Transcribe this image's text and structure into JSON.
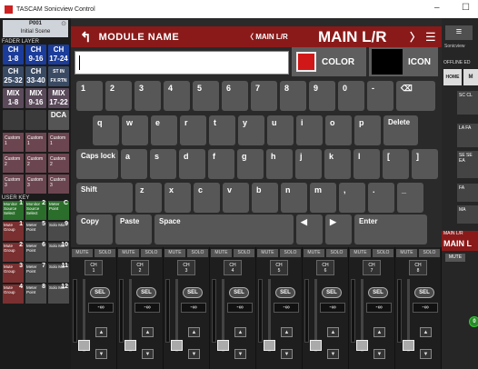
{
  "window": {
    "title": "TASCAM Sonicview Control",
    "controls": [
      "–",
      "☐"
    ]
  },
  "left_panel": {
    "preset": {
      "number": "P001",
      "name": "Initial Scene",
      "scroll": "⊙"
    },
    "fader_layer_label": "FADER LAYER",
    "layers": [
      {
        "l1": "CH",
        "l2": "1-8",
        "style": "ch"
      },
      {
        "l1": "CH",
        "l2": "9-16",
        "style": "ch"
      },
      {
        "l1": "CH",
        "l2": "17-24",
        "style": "ch"
      },
      {
        "l1": "CH",
        "l2": "25-32",
        "style": "chg"
      },
      {
        "l1": "CH",
        "l2": "33-40",
        "style": "chg"
      },
      {
        "l1": "ST IN",
        "l2": "FX RTN",
        "style": "chg"
      },
      {
        "l1": "MIX",
        "l2": "1-8",
        "style": "mix"
      },
      {
        "l1": "MIX",
        "l2": "9-16",
        "style": "mix"
      },
      {
        "l1": "MIX",
        "l2": "17-22",
        "style": "mix"
      },
      {
        "l1": "",
        "l2": "",
        "style": "empty"
      },
      {
        "l1": "",
        "l2": "",
        "style": "empty"
      },
      {
        "l1": "DCA",
        "l2": "",
        "style": "dca"
      }
    ],
    "custom": [
      {
        "t": "Custom",
        "n": "1"
      },
      {
        "t": "Custom",
        "n": "1"
      },
      {
        "t": "Custom",
        "n": "1"
      },
      {
        "t": "Custom",
        "n": "2"
      },
      {
        "t": "Custom",
        "n": "2"
      },
      {
        "t": "Custom",
        "n": "2"
      },
      {
        "t": "Custom",
        "n": "3"
      },
      {
        "t": "Custom",
        "n": "3"
      },
      {
        "t": "Custom",
        "n": "3"
      }
    ],
    "user_key_label": "USER KEY",
    "user_keys": [
      {
        "t": "Monitor Source Select",
        "n": "1",
        "s": ""
      },
      {
        "t": "Monitor Source Select",
        "n": "2",
        "s": ""
      },
      {
        "t": "Meter Point",
        "n": "C",
        "s": "Meter"
      },
      {
        "t": "Mute Group",
        "n": "1",
        "s": "mg"
      },
      {
        "t": "Meter Point",
        "n": "5",
        "s": "lk"
      },
      {
        "t": "Solo Mix",
        "n": "9",
        "s": "lk"
      },
      {
        "t": "Mute Group",
        "n": "2",
        "s": "mg"
      },
      {
        "t": "Meter Point",
        "n": "6",
        "s": "lk"
      },
      {
        "t": "Solo Mix",
        "n": "10",
        "s": "lk"
      },
      {
        "t": "Mute Group",
        "n": "3",
        "s": "mg"
      },
      {
        "t": "Meter Point",
        "n": "7",
        "s": "lk"
      },
      {
        "t": "Solo Mix",
        "n": "11",
        "s": "lk"
      },
      {
        "t": "Mute Group",
        "n": "4",
        "s": "mg"
      },
      {
        "t": "Meter Point",
        "n": "8",
        "s": "lk"
      },
      {
        "t": "Solo Mix",
        "n": "12",
        "s": "lk"
      }
    ]
  },
  "header": {
    "back": "↰",
    "title": "MODULE NAME",
    "prev_label": "〈 MAIN L/R",
    "current": "MAIN L/R",
    "next": "〉",
    "menu": "☰"
  },
  "name_input": {
    "value": ""
  },
  "color_button": {
    "label": "COLOR",
    "color": "#d01818"
  },
  "icon_button": {
    "label": "ICON"
  },
  "keyboard": {
    "row1": [
      "1",
      "2",
      "3",
      "4",
      "5",
      "6",
      "7",
      "8",
      "9",
      "0",
      "-",
      "⌫"
    ],
    "row2": [
      "q",
      "w",
      "e",
      "r",
      "t",
      "y",
      "u",
      "i",
      "o",
      "p",
      "Delete"
    ],
    "row3": [
      "Caps lock",
      "a",
      "s",
      "d",
      "f",
      "g",
      "h",
      "j",
      "k",
      "l",
      "[",
      "]"
    ],
    "row4": [
      "Shift",
      "z",
      "x",
      "c",
      "v",
      "b",
      "n",
      "m",
      ",",
      ".",
      "_"
    ],
    "row5": [
      "Copy",
      "Paste",
      "Space",
      "◀",
      "▶",
      "Enter"
    ]
  },
  "strips": [
    {
      "mute": "MUTE",
      "solo": "SOLO",
      "ch": "CH",
      "num": "1",
      "sel": "SEL",
      "db": "-∞"
    },
    {
      "mute": "MUTE",
      "solo": "SOLO",
      "ch": "CH",
      "num": "2",
      "sel": "SEL",
      "db": "-∞"
    },
    {
      "mute": "MUTE",
      "solo": "SOLO",
      "ch": "CH",
      "num": "3",
      "sel": "SEL",
      "db": "-∞"
    },
    {
      "mute": "MUTE",
      "solo": "SOLO",
      "ch": "CH",
      "num": "4",
      "sel": "SEL",
      "db": "-∞"
    },
    {
      "mute": "MUTE",
      "solo": "SOLO",
      "ch": "CH",
      "num": "5",
      "sel": "SEL",
      "db": "-∞"
    },
    {
      "mute": "MUTE",
      "solo": "SOLO",
      "ch": "CH",
      "num": "6",
      "sel": "SEL",
      "db": "-∞"
    },
    {
      "mute": "MUTE",
      "solo": "SOLO",
      "ch": "CH",
      "num": "7",
      "sel": "SEL",
      "db": "-∞"
    },
    {
      "mute": "MUTE",
      "solo": "SOLO",
      "ch": "CH",
      "num": "8",
      "sel": "SEL",
      "db": "-∞"
    }
  ],
  "right_panel": {
    "menu": "≡",
    "brand": "Sonicview",
    "offline": "OFFLINE ED",
    "home": "HOME",
    "m2": "M",
    "b1": "SC CL",
    "b2": "LA FA",
    "b3": "SE SE EA",
    "b4": "FA",
    "b5": "MA",
    "mlr_small": "MAIN L/R",
    "mlr_big": "MAIN L",
    "mute": "MUTE",
    "sel": "0"
  }
}
